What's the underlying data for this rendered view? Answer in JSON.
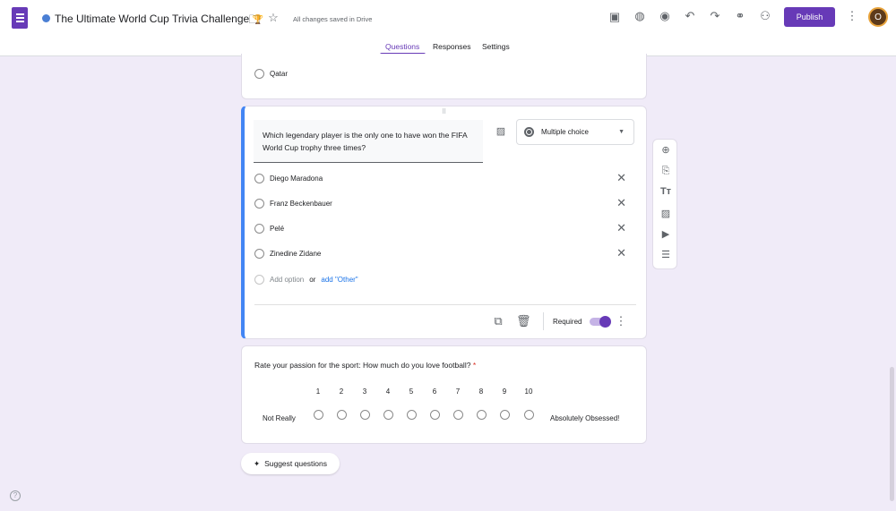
{
  "header": {
    "title": "The Ultimate World Cup Trivia Challenge",
    "trophy": "🏆",
    "saved": "All changes saved in Drive",
    "publish": "Publish",
    "avatar": "O"
  },
  "tabs": [
    "Questions",
    "Responses",
    "Settings"
  ],
  "prev_card": {
    "option": "Qatar"
  },
  "question": {
    "text": "Which legendary player is the only one to have won the FIFA World Cup trophy three times?",
    "type": "Multiple choice",
    "options": [
      "Diego Maradona",
      "Franz Beckenbauer",
      "Pelé",
      "Zinedine Zidane"
    ],
    "add_option": "Add option",
    "or": "or",
    "add_other": "add \"Other\"",
    "required": "Required"
  },
  "scale": {
    "text": "Rate your passion for the sport: How much do you love football?",
    "asterisk": "*",
    "numbers": [
      "1",
      "2",
      "3",
      "4",
      "5",
      "6",
      "7",
      "8",
      "9",
      "10"
    ],
    "low": "Not Really",
    "high": "Absolutely Obsessed!"
  },
  "suggest": "Suggest questions",
  "help": "?"
}
